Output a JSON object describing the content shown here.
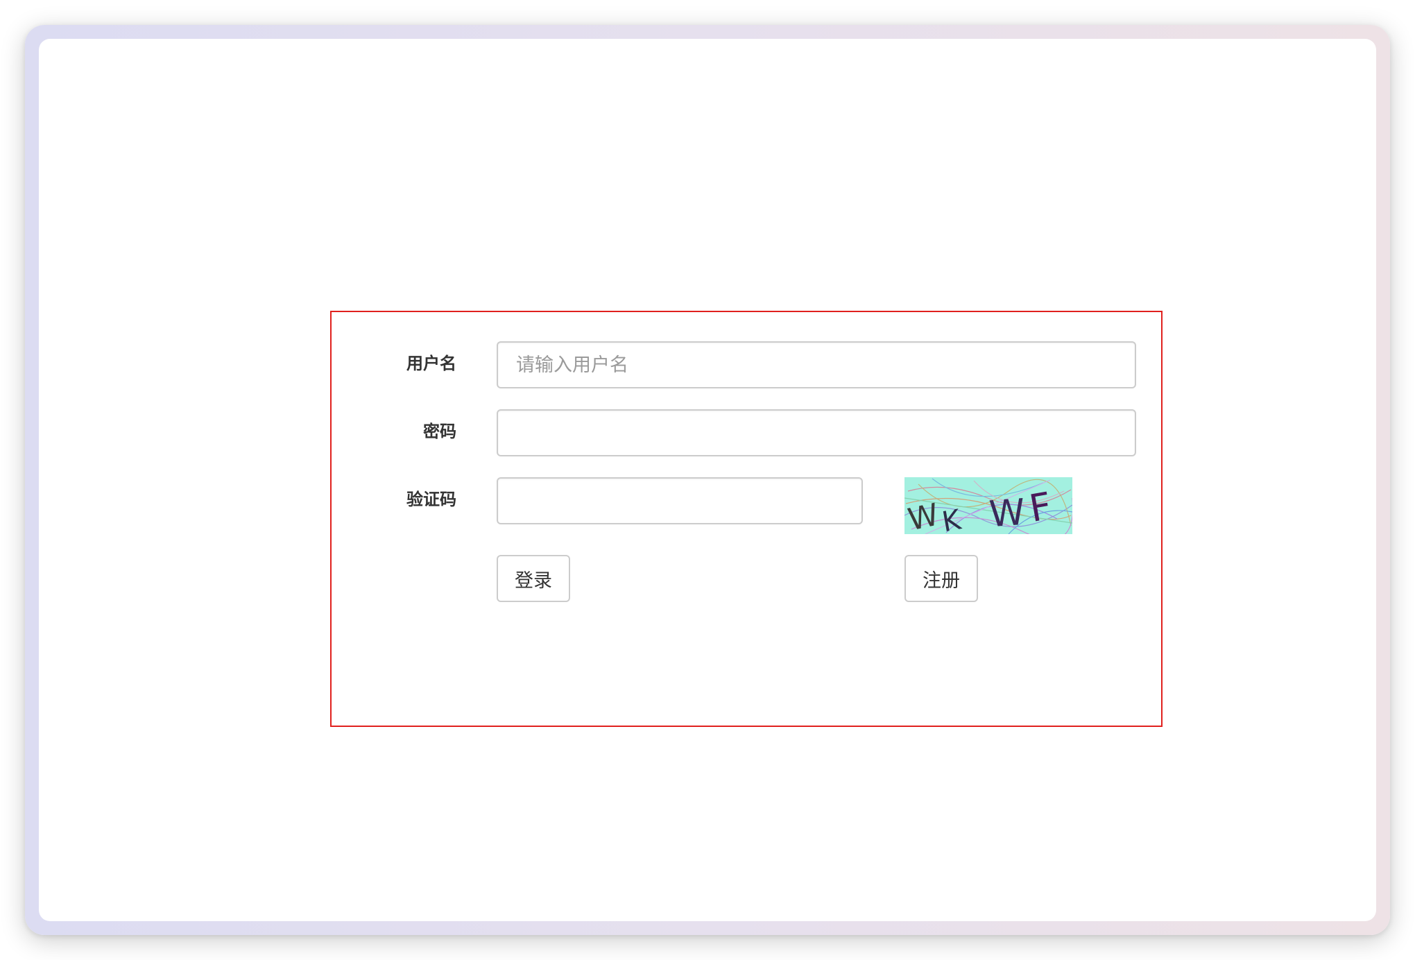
{
  "form": {
    "username_label": "用户名",
    "username_placeholder": "请输入用户名",
    "username_value": "",
    "password_label": "密码",
    "password_value": "",
    "captcha_label": "验证码",
    "captcha_value": "",
    "captcha_text": "WK WF",
    "login_label": "登录",
    "register_label": "注册"
  },
  "colors": {
    "box_border": "#e0201d",
    "captcha_bg": "#a3f0e0"
  }
}
